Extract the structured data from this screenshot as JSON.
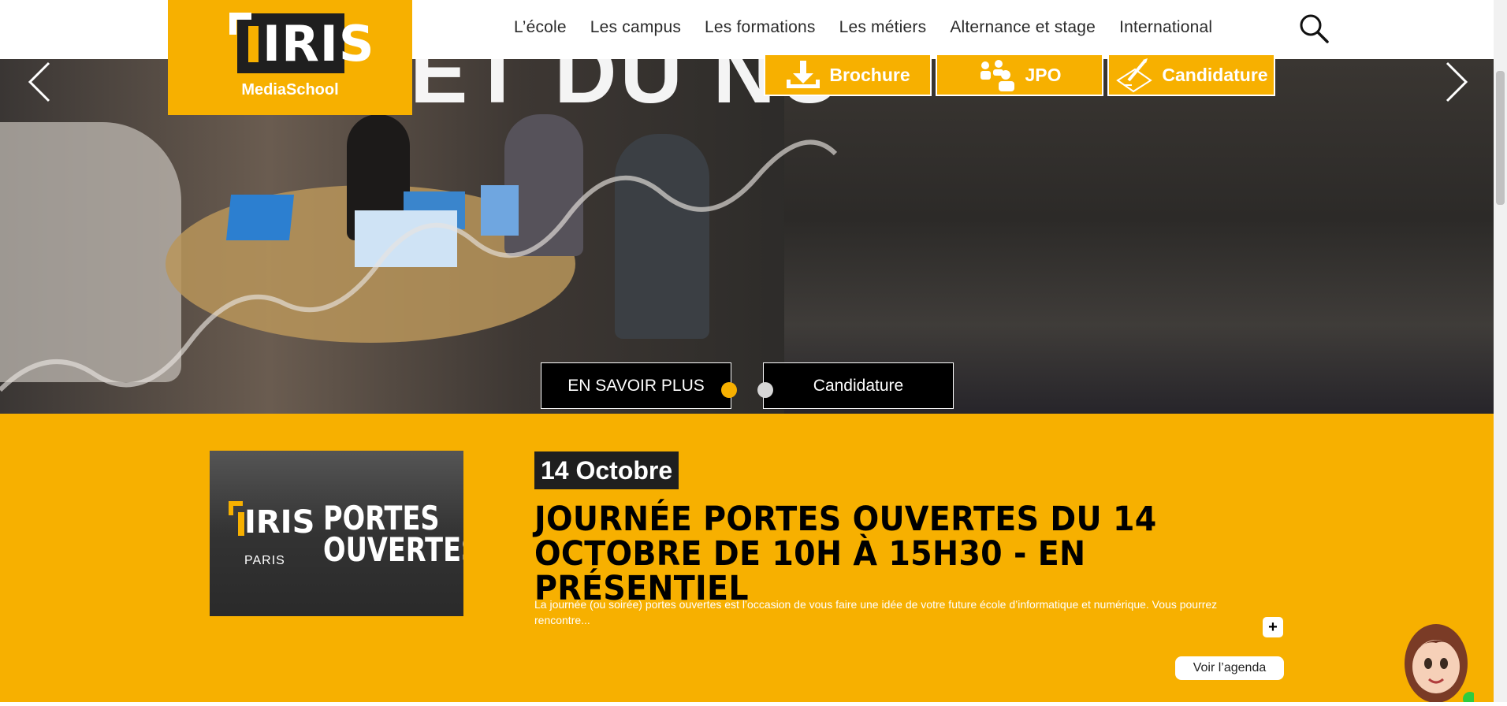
{
  "brand": {
    "logo_text": "IRIS",
    "logo_sub": "MediaSchool"
  },
  "nav": {
    "items": [
      "L’école",
      "Les campus",
      "Les formations",
      "Les métiers",
      "Alternance et stage",
      "International"
    ]
  },
  "hero": {
    "headline": "ET DU NU",
    "cta": {
      "brochure": "Brochure",
      "jpo": "JPO",
      "candidature": "Candidature"
    },
    "btn_more": "EN SAVOIR PLUS",
    "btn_apply": "Candidature",
    "slides": {
      "count": 2,
      "active": 1
    }
  },
  "event": {
    "thumb": {
      "logo": "IRIS",
      "city": "PARIS",
      "title_line1": "PORTES",
      "title_line2": "OUVERTES"
    },
    "date": "14 Octobre",
    "title": "JOURNÉE PORTES OUVERTES DU 14 OCTOBRE DE 10H À 15H30 - EN PRÉSENTIEL",
    "description": "La journée (ou soirée) portes ouvertes est l’occasion de vous faire une idée de votre future école d’informatique et numérique. Vous pourrez rencontre...",
    "plus": "+",
    "agenda": "Voir l’agenda"
  },
  "colors": {
    "accent": "#f7b000",
    "dark": "#1f1f1f",
    "white": "#ffffff"
  },
  "icons": [
    "search-icon",
    "download-icon",
    "people-icon",
    "pen-sign-icon",
    "chevron-left-icon",
    "chevron-right-icon"
  ]
}
